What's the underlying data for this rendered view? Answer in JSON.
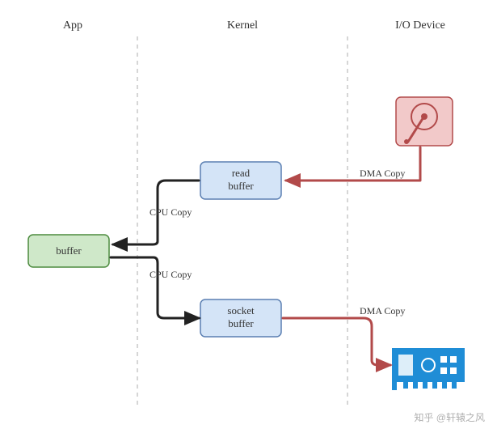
{
  "columns": {
    "app": "App",
    "kernel": "Kernel",
    "io": "I/O Device"
  },
  "nodes": {
    "app_buffer": "buffer",
    "read_buffer_l1": "read",
    "read_buffer_l2": "buffer",
    "socket_buffer_l1": "socket",
    "socket_buffer_l2": "buffer",
    "disk_icon": "disk-icon",
    "nic_icon": "nic-icon"
  },
  "edges": {
    "disk_to_read": "DMA Copy",
    "read_to_app": "CPU Copy",
    "app_to_socket": "CPU Copy",
    "socket_to_nic": "DMA Copy"
  },
  "flow": [
    "Disk device → DMA Copy → read buffer (Kernel)",
    "read buffer → CPU Copy → buffer (App user space)",
    "buffer (App user space) → CPU Copy → socket buffer (Kernel)",
    "socket buffer → DMA Copy → Network card device"
  ],
  "colors": {
    "app_fill": "#cfe8c9",
    "app_stroke": "#4d8b3f",
    "kernel_fill": "#d4e4f7",
    "kernel_stroke": "#5b7fb2",
    "disk_fill": "#f2c9c9",
    "disk_stroke": "#b24a4a",
    "nic_fill": "#1f8dd6",
    "arrow_red": "#b24a4a",
    "arrow_black": "#222"
  },
  "watermark": "知乎 @轩辕之风"
}
